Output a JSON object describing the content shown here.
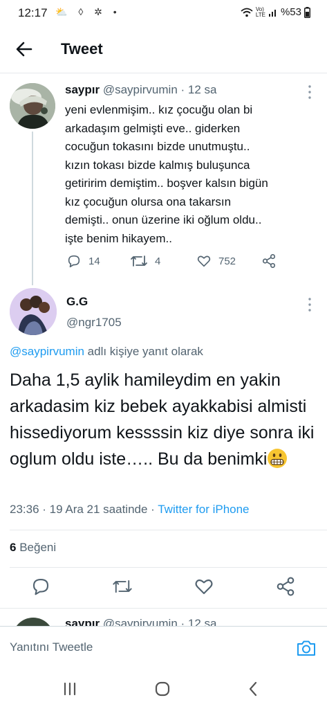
{
  "status_bar": {
    "time": "12:17",
    "left_icons": "⛅ ◊ ✲ •",
    "net_top": "Vo)",
    "net_bottom": "LTE",
    "battery": "%53"
  },
  "header": {
    "title": "Tweet"
  },
  "parent_tweet": {
    "name": "saypır",
    "handle": "@saypirvumin",
    "time": "· 12 sa",
    "text": "yeni evlenmişim.. kız çocuğu olan bi\narkadaşım gelmişti eve.. giderken\ncocuğun tokasını bizde unutmuştu..\nkızın tokası bizde kalmış buluşunca\ngetiririm demiştim.. boşver kalsın bigün\nkız çocuğun olursa ona takarsın\ndemişti.. onun üzerine iki oğlum oldu..\nişte benim hikayem..",
    "replies": "14",
    "retweets": "4",
    "likes": "752"
  },
  "main_tweet": {
    "name": "G.G",
    "handle": "@ngr1705",
    "reply_to_mention": "@saypirvumin",
    "reply_to_suffix": " adlı kişiye yanıt olarak",
    "text": "Daha 1,5 aylik hamileydim en yakin arkadasim kiz bebek ayakkabisi almisti hissediyorum kessssin kiz diye sonra iki oglum oldu iste….. Bu da benimki",
    "time": "23:36",
    "date": " · 19 Ara 21 saatinde · ",
    "source": "Twitter for iPhone",
    "like_count": "6",
    "like_label": " Beğeni"
  },
  "next_tweet": {
    "name": "saypır",
    "handle": "@saypirvumin · 12 sa"
  },
  "reply_bar": {
    "placeholder": "Yanıtını Tweetle"
  },
  "colors": {
    "accent": "#1d9bf0",
    "secondary_text": "#536471",
    "primary_text": "#0f1419"
  }
}
